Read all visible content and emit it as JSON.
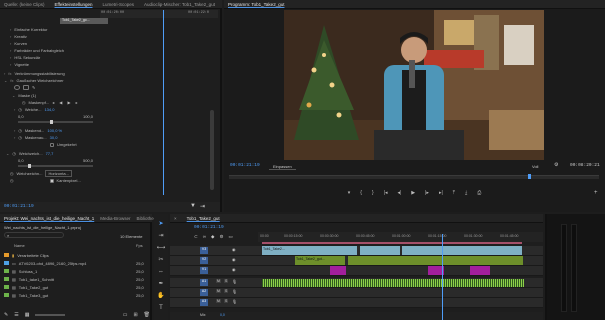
{
  "source_panel": {
    "tabs": [
      "Quelle: (keine Clips)",
      "Effekteinstellungen",
      "Lumetri-Scopes",
      "Audioclip-Mischer: Tob1_Take2_gut"
    ],
    "clip_header": "Tob1_Take2_go...",
    "timecode_start": "00:01:20:00",
    "timecode_end": "00:01:22:0",
    "effects": [
      {
        "label": "Einfache Korrektur"
      },
      {
        "label": "Kreativ"
      },
      {
        "label": "Kurven"
      },
      {
        "label": "Farbräder und Farbabgleich"
      },
      {
        "label": "HSL Sekundär"
      },
      {
        "label": "Vignette"
      },
      {
        "label": "Verkrümmungsstabilisierung"
      },
      {
        "label": "Gaußscher Weichzeichner"
      }
    ],
    "mask_label": "Maske (1)",
    "mask_rows": [
      {
        "label": "Maskenpf..."
      },
      {
        "label": "Weiche...",
        "value": "134,0"
      }
    ],
    "scale_min": "0,0",
    "scale_max": "100,0",
    "props": [
      {
        "label": "Maskend...",
        "value": "100,0 %"
      },
      {
        "label": "Maskenau...",
        "value": "30,0"
      },
      {
        "label": "",
        "value": "Umgekehrt"
      },
      {
        "label": "Weichzeich...",
        "value": "77,7"
      }
    ],
    "scale2_min": "0,0",
    "scale2_max": "500,0",
    "dims_label": "Weichzeichn...",
    "dims_value": "Horizonta...",
    "edge_label": "Kantenpixel...",
    "bottom_timecode": "00:01:21:19"
  },
  "program_monitor": {
    "title": "Programm: Tob1_Take2_gut",
    "timecode": "00:01:21:19",
    "fit": "Einpassen",
    "quality": "Voll",
    "duration": "00:08:20:21"
  },
  "project_panel": {
    "tabs": [
      "Projekt: Wei_nachts_ist_die_heilige_Nacht_1",
      "Media-Browser",
      "Bibliothek"
    ],
    "project_file": "Wei_nachts_ist_die_heilige_Nacht_1.prproj",
    "item_count": "10 Elemente",
    "column_name": "Name",
    "column_fps": "Fps",
    "items": [
      {
        "name": "Verarbeitete Clips",
        "fps": "",
        "color": "#e59a2b"
      },
      {
        "name": "ATV6203-ohd_4896_2160_25fps.mp4",
        "fps": "25,0",
        "color": "#4ea1e5"
      },
      {
        "name": "Schluss_1",
        "fps": "25,0",
        "color": "#6db34a"
      },
      {
        "name": "Tob1_take1_Schnitt",
        "fps": "25,0",
        "color": "#6db34a"
      },
      {
        "name": "Tob1_Take2_gut",
        "fps": "25,0",
        "color": "#6db34a"
      },
      {
        "name": "Tob1_Take3_gut",
        "fps": "25,0",
        "color": "#6db34a"
      }
    ]
  },
  "timeline": {
    "sequence_name": "Tob1_Take2_gut",
    "timecode": "00:01:21:19",
    "ruler": [
      "00:00",
      "00:00:15:00",
      "00:00:30:00",
      "00:00:45:00",
      "00:01:00:00",
      "00:01:15:00",
      "00:01:30:00",
      "00:01:45:00",
      "00:02:00:00"
    ],
    "video_tracks": [
      "V3",
      "V2",
      "V1"
    ],
    "audio_tracks": [
      "A1",
      "A2",
      "A3"
    ],
    "master_label": "Mix",
    "master_value": "0,0",
    "clips": [
      {
        "track": "V3",
        "label": "Tob1_Take2..."
      },
      {
        "track": "V2",
        "label": "Tob1_Take2_gut..."
      },
      {
        "track": "V1",
        "label": ""
      }
    ]
  },
  "colors": {
    "accent": "#4f9df7",
    "video_clip": "#7fb0c4",
    "magenta_clip": "#a21f9c",
    "green_clip": "#6d8f2a",
    "audio_wave": "#8fd04a"
  }
}
